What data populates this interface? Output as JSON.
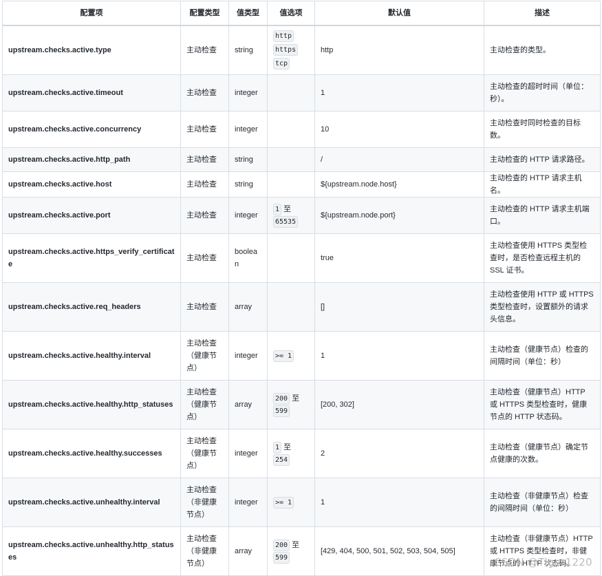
{
  "table": {
    "headers": [
      "配置项",
      "配置类型",
      "值类型",
      "值选项",
      "默认值",
      "描述"
    ],
    "rows": [
      {
        "key": "upstream.checks.active.type",
        "ctype": "主动检查",
        "vtype": "string",
        "options_list": [
          "http",
          "https",
          "tcp"
        ],
        "default": "http",
        "desc": "主动检查的类型。"
      },
      {
        "key": "upstream.checks.active.timeout",
        "ctype": "主动检查",
        "vtype": "integer",
        "default": "1",
        "desc": "主动检查的超时时间（单位：秒）。"
      },
      {
        "key": "upstream.checks.active.concurrency",
        "ctype": "主动检查",
        "vtype": "integer",
        "default": "10",
        "desc": "主动检查时同时检查的目标数。"
      },
      {
        "key": "upstream.checks.active.http_path",
        "ctype": "主动检查",
        "vtype": "string",
        "default": "/",
        "desc": "主动检查的 HTTP 请求路径。"
      },
      {
        "key": "upstream.checks.active.host",
        "ctype": "主动检查",
        "vtype": "string",
        "default": "${upstream.node.host}",
        "desc": "主动检查的 HTTP 请求主机名。"
      },
      {
        "key": "upstream.checks.active.port",
        "ctype": "主动检查",
        "vtype": "integer",
        "range": {
          "from": "1",
          "sep": "至",
          "to": "65535"
        },
        "default": "${upstream.node.port}",
        "desc": "主动检查的 HTTP 请求主机端口。"
      },
      {
        "key": "upstream.checks.active.https_verify_certificate",
        "ctype": "主动检查",
        "vtype": "boolean",
        "default": "true",
        "desc": "主动检查使用 HTTPS 类型检查时，是否检查远程主机的 SSL 证书。"
      },
      {
        "key": "upstream.checks.active.req_headers",
        "ctype": "主动检查",
        "vtype": "array",
        "default": "[]",
        "desc": "主动检查使用 HTTP 或 HTTPS 类型检查时，设置额外的请求头信息。"
      },
      {
        "key": "upstream.checks.active.healthy.interval",
        "ctype": "主动检查（健康节点）",
        "vtype": "integer",
        "single": ">= 1",
        "default": "1",
        "desc": "主动检查（健康节点）检查的间隔时间（单位：秒）"
      },
      {
        "key": "upstream.checks.active.healthy.http_statuses",
        "ctype": "主动检查（健康节点）",
        "vtype": "array",
        "range": {
          "from": "200",
          "sep": "至",
          "to": "599"
        },
        "default": "[200, 302]",
        "desc": "主动检查（健康节点）HTTP 或 HTTPS 类型检查时，健康节点的 HTTP 状态码。"
      },
      {
        "key": "upstream.checks.active.healthy.successes",
        "ctype": "主动检查（健康节点）",
        "vtype": "integer",
        "range": {
          "from": "1",
          "sep": "至",
          "to": "254"
        },
        "default": "2",
        "desc": "主动检查（健康节点）确定节点健康的次数。"
      },
      {
        "key": "upstream.checks.active.unhealthy.interval",
        "ctype": "主动检查（非健康节点）",
        "vtype": "integer",
        "single": ">= 1",
        "default": "1",
        "desc": "主动检查（非健康节点）检查的间隔时间（单位：秒）"
      },
      {
        "key": "upstream.checks.active.unhealthy.http_statuses",
        "ctype": "主动检查（非健康节点）",
        "vtype": "array",
        "range": {
          "from": "200",
          "sep": "至",
          "to": "599"
        },
        "default": "[429, 404, 500, 501, 502, 503, 504, 505]",
        "desc": "主动检查（非健康节点）HTTP 或 HTTPS 类型检查时，非健康节点的 HTTP 状态码。"
      }
    ]
  },
  "watermark": "CSDN @Tiger1220"
}
